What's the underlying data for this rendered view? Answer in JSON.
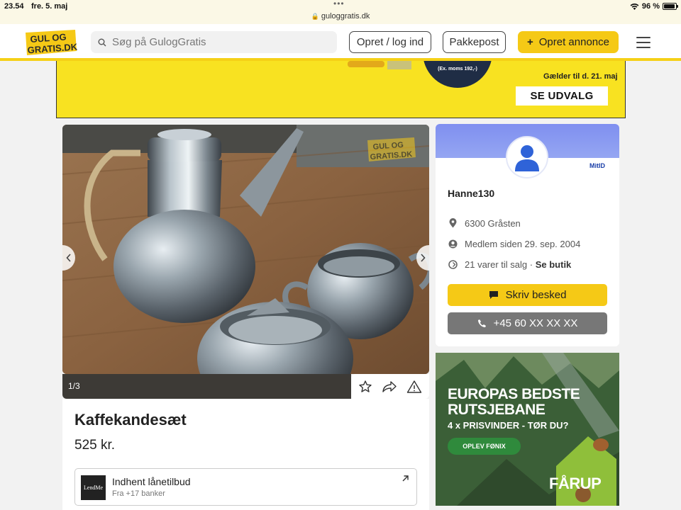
{
  "statusbar": {
    "time": "23.54",
    "date": "fre. 5. maj",
    "url": "guloggratis.dk",
    "battery": "96 %"
  },
  "header": {
    "logo_alt": "GUL OG GRATIS.DK",
    "search_placeholder": "Søg på GulogGratis",
    "login_label": "Opret / log ind",
    "pakkepost_label": "Pakkepost",
    "create_label": "Opret annonce",
    "accent": "#f5c916"
  },
  "ad_banner": {
    "price_note": "(Ex. moms 192,-)",
    "valid_text": "Gælder til d. 21. maj",
    "cta": "SE UDVALG"
  },
  "gallery": {
    "counter": "1/3",
    "watermark": "GUL OG GRATIS.DK"
  },
  "listing": {
    "title": "Kaffekandesæt",
    "price": "525 kr."
  },
  "loan": {
    "logo": "LendMe",
    "title": "Indhent lånetilbud",
    "subtitle": "Fra +17 banker"
  },
  "seller": {
    "name": "Hanne130",
    "verified": "MitID",
    "location": "6300 Gråsten",
    "member_since": "Medlem siden 29. sep. 2004",
    "items_for_sale": "21 varer til salg ·",
    "shop_link": "Se butik",
    "message_label": "Skriv besked",
    "phone_label": "+45 60 XX XX XX"
  },
  "side_ad": {
    "headline_1": "EUROPAS BEDSTE",
    "headline_2": "RUTSJEBANE",
    "subline": "4 x PRISVINDER - TØR DU?",
    "cta": "OPLEV FØNIX",
    "brand": "FÅRUP"
  }
}
